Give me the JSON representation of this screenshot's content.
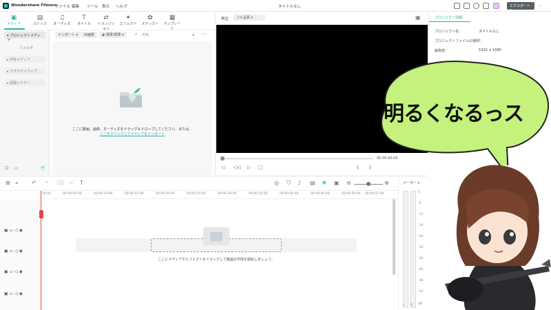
{
  "app": {
    "name": "Wondershare Filmora",
    "document_title": "タイトルなし",
    "export_label": "エクスポート"
  },
  "menu": [
    "ファイル",
    "編集",
    "ツール",
    "表示",
    "ヘルプ"
  ],
  "library_tabs": [
    {
      "label": "メディア",
      "icon": "media-icon",
      "glyph": "▣",
      "active": true
    },
    {
      "label": "ストック",
      "icon": "stock-icon",
      "glyph": "▤"
    },
    {
      "label": "オーディオ",
      "icon": "music-icon",
      "glyph": "♫"
    },
    {
      "label": "タイトル",
      "icon": "title-icon",
      "glyph": "T"
    },
    {
      "label": "トランジション",
      "icon": "transition-icon",
      "glyph": "⇄"
    },
    {
      "label": "エフェクト",
      "icon": "effect-icon",
      "glyph": "✦"
    },
    {
      "label": "ステッカー",
      "icon": "sticker-icon",
      "glyph": "✿"
    },
    {
      "label": "テンプレート",
      "icon": "template-icon",
      "glyph": "▦"
    }
  ],
  "sidebar": {
    "items": [
      "プロジェクトメディア",
      "フォルダ",
      "共有メディア",
      "クラウドメディア",
      "調整レイヤー"
    ]
  },
  "media_filters": {
    "import": "インポート",
    "ai_image": "AI画像",
    "sort": "標準/標準",
    "search_placeholder": "検索"
  },
  "drop_area": {
    "line1": "ここに動画、画像、オーディオをドラッグ＆ドロップしてください。または、",
    "line2": "ここをクリックしてメディアをインポート"
  },
  "preview": {
    "label": "再生",
    "quality": "フル品質",
    "timecode": "00:00:00:00"
  },
  "properties": {
    "tab_label": "プロジェクト情報",
    "rows": [
      {
        "label": "プロジェクト名：",
        "value": "タイトルなし"
      },
      {
        "label": "プロジェクトファイルの場所：",
        "value": "/"
      },
      {
        "label": "解像度：",
        "value": "1920 × 1080"
      }
    ]
  },
  "timeline": {
    "ruler": [
      "00:00",
      "00:00:05:00",
      "00:00:10:00",
      "00:00:15:00",
      "00:00:20:00",
      "00:00:25:00",
      "00:00:30:00",
      "00:00:35:00",
      "00:00:40:00",
      "00:00:45:00",
      "00:00:50:00",
      "00:00:55:00"
    ],
    "drop_text": "ここにメディアやエフェクトをドラッグして動画の作成を開始しましょう。"
  },
  "meter": {
    "label": "メーター",
    "ticks": [
      "0",
      "-6",
      "-12",
      "-18",
      "-24",
      "-30",
      "-36",
      "-42",
      "-48",
      "-54"
    ],
    "channels": [
      "L",
      "R"
    ],
    "bottom": "dB"
  },
  "speech_bubble": {
    "text": "明るくなるっス",
    "color": "#c4f27c"
  },
  "colors": {
    "accent": "#2fb3a6",
    "playhead": "#e0494b"
  }
}
